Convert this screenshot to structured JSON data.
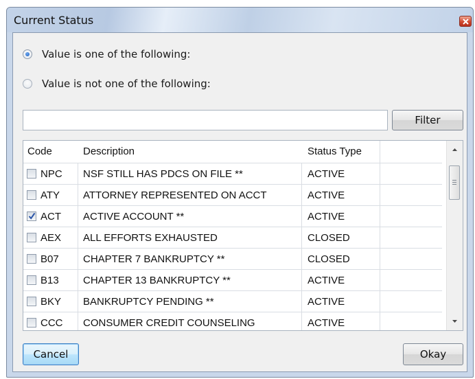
{
  "window": {
    "title": "Current Status"
  },
  "options": {
    "include_label": "Value is one of the following:",
    "exclude_label": "Value is not one of the following:",
    "selected": "include"
  },
  "filter": {
    "value": "",
    "button_label": "Filter"
  },
  "table": {
    "headers": [
      "Code",
      "Description",
      "Status Type"
    ],
    "rows": [
      {
        "code": "NPC",
        "description": "NSF STILL HAS PDCS ON FILE **",
        "status_type": "ACTIVE",
        "checked": false
      },
      {
        "code": "ATY",
        "description": "ATTORNEY REPRESENTED ON ACCT",
        "status_type": "ACTIVE",
        "checked": false
      },
      {
        "code": "ACT",
        "description": "ACTIVE ACCOUNT **",
        "status_type": "ACTIVE",
        "checked": true
      },
      {
        "code": "AEX",
        "description": "ALL EFFORTS EXHAUSTED",
        "status_type": "CLOSED",
        "checked": false
      },
      {
        "code": "B07",
        "description": "CHAPTER 7 BANKRUPTCY **",
        "status_type": "CLOSED",
        "checked": false
      },
      {
        "code": "B13",
        "description": "CHAPTER 13 BANKRUPTCY **",
        "status_type": "ACTIVE",
        "checked": false
      },
      {
        "code": "BKY",
        "description": "BANKRUPTCY PENDING **",
        "status_type": "ACTIVE",
        "checked": false
      },
      {
        "code": "CCC",
        "description": "CONSUMER CREDIT COUNSELING",
        "status_type": "ACTIVE",
        "checked": false
      }
    ]
  },
  "footer": {
    "cancel_label": "Cancel",
    "okay_label": "Okay"
  },
  "icons": {
    "close": "close-icon",
    "check": "checkmark-icon",
    "scroll_up": "scroll-up-arrow-icon",
    "scroll_down": "scroll-down-arrow-icon"
  },
  "colors": {
    "title_bar": "#c3d3e8",
    "close_button": "#d24a30",
    "default_button_border": "#3b7fc4"
  }
}
